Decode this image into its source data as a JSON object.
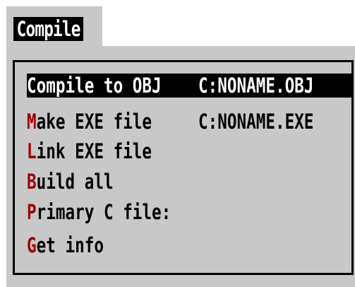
{
  "menu": {
    "title": "Compile",
    "items": [
      {
        "hotkey": "C",
        "rest": "ompile to OBJ",
        "value": "C:NONAME.OBJ",
        "selected": true
      },
      {
        "hotkey": "M",
        "rest": "ake EXE file",
        "value": "C:NONAME.EXE",
        "selected": false
      },
      {
        "hotkey": "L",
        "rest": "ink EXE file",
        "value": "",
        "selected": false
      },
      {
        "hotkey": "B",
        "rest": "uild all",
        "value": "",
        "selected": false
      },
      {
        "hotkey": "P",
        "rest": "rimary C file:",
        "value": "",
        "selected": false
      },
      {
        "hotkey": "G",
        "rest": "et info",
        "value": "",
        "selected": false
      }
    ]
  },
  "colors": {
    "panel": "#c8c8c8",
    "hotkey": "#a00000",
    "selection": "#000000",
    "selection_text": "#ffffff"
  }
}
